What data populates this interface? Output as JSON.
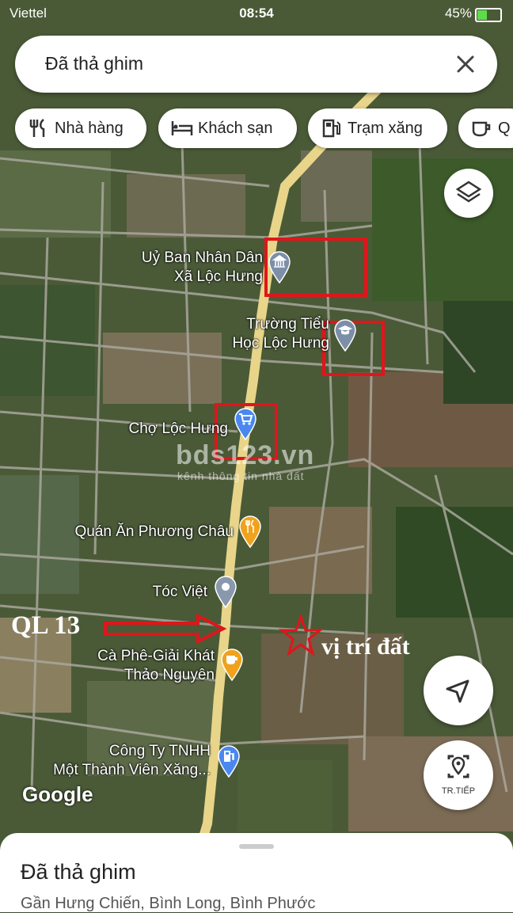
{
  "status_bar": {
    "carrier": "Viettel",
    "time": "08:54",
    "battery": "45%"
  },
  "search": {
    "query": "Đã thả ghim"
  },
  "chips": [
    {
      "label": "Nhà hàng",
      "icon": "fork-knife-icon"
    },
    {
      "label": "Khách sạn",
      "icon": "bed-icon"
    },
    {
      "label": "Trạm xăng",
      "icon": "gas-pump-icon"
    },
    {
      "label": "Q",
      "icon": "coffee-cup-icon"
    }
  ],
  "map": {
    "places": [
      {
        "name": "Uỷ Ban Nhân Dân\nXã Lộc Hưng",
        "icon": "government-building-icon",
        "color": "#7d8fa8"
      },
      {
        "name": "Trường Tiểu\nHọc Lộc Hưng",
        "icon": "school-icon",
        "color": "#7d8fa8"
      },
      {
        "name": "Chợ Lộc Hưng",
        "icon": "shopping-cart-icon",
        "color": "#4a88f0"
      },
      {
        "name": "Quán Ăn Phương Châu",
        "icon": "restaurant-icon",
        "color": "#f0a21d"
      },
      {
        "name": "Tóc Việt",
        "icon": "location-pin-icon",
        "color": "#8a98ad"
      },
      {
        "name": "Cà Phê-Giải Khát\nThảo Nguyên",
        "icon": "coffee-icon",
        "color": "#f0a21d"
      },
      {
        "name": "Công Ty TNHH\nMột Thành Viên Xăng...",
        "icon": "gas-station-icon",
        "color": "#4a88f0"
      }
    ],
    "annotations": {
      "road": "QL 13",
      "site": "vị trí đất",
      "highlight_color": "#e0151b"
    },
    "watermark": {
      "brand": "bds123.vn",
      "tagline": "kênh thông tin nhà đất"
    },
    "attribution": "Google"
  },
  "controls": {
    "layers_icon": "layers-icon",
    "locate_icon": "navigation-arrow-icon",
    "streetview_label": "TR.TIẾP"
  },
  "sheet": {
    "title": "Đã thả ghim",
    "address": "Gần Hưng Chiến, Bình Long, Bình Phước"
  }
}
